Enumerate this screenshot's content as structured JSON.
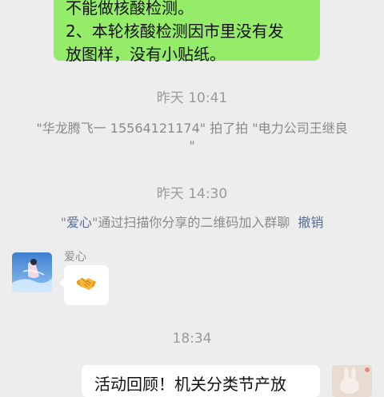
{
  "messages": {
    "green_bubble": {
      "line1": "不能做核酸检测。",
      "line2": "2、本轮核酸检测因市里没有发",
      "line3": "放图样，没有小贴纸。"
    },
    "timestamp1": "昨天 10:41",
    "pat_notice": {
      "line1": "\"华龙腾飞一 15564121174\" 拍了拍 \"电力公司王继良",
      "line2": "\""
    },
    "timestamp2": "昨天 14:30",
    "join_notice": {
      "quote_open": "\"",
      "name": "爱心",
      "text": "\"通过扫描你分享的二维码加入群聊",
      "revoke": "撤销"
    },
    "incoming": {
      "sender": "爱心",
      "emoji": "handshake-emoji"
    },
    "timestamp3": "18:34",
    "bottom_bubble": {
      "text": "活动回顾！机关分类节产放"
    }
  },
  "colors": {
    "background": "#ededed",
    "green_bubble": "#95ec69",
    "link": "#576b95",
    "timestamp": "#9a9a9a"
  }
}
